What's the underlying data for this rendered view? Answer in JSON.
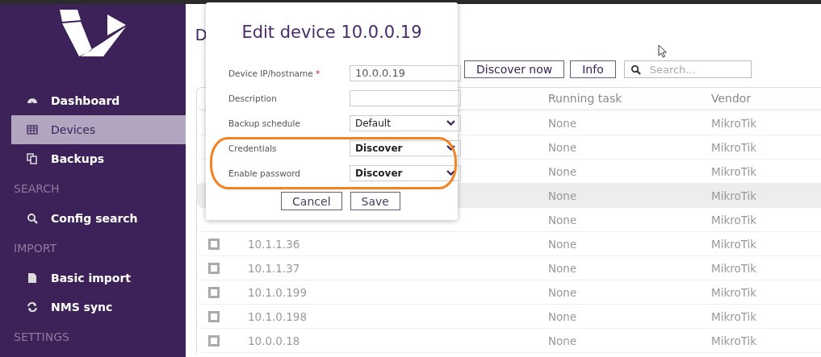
{
  "sidebar": {
    "items": [
      {
        "kind": "item",
        "label": "Dashboard",
        "selected": false
      },
      {
        "kind": "item",
        "label": "Devices",
        "selected": true
      },
      {
        "kind": "item",
        "label": "Backups",
        "selected": false
      },
      {
        "kind": "section",
        "label": "SEARCH"
      },
      {
        "kind": "item",
        "label": "Config search",
        "selected": false
      },
      {
        "kind": "section",
        "label": "IMPORT"
      },
      {
        "kind": "item",
        "label": "Basic import",
        "selected": false
      },
      {
        "kind": "item",
        "label": "NMS sync",
        "selected": false
      },
      {
        "kind": "section",
        "label": "SETTINGS"
      }
    ]
  },
  "page_title": "D",
  "toolbar": {
    "buttons": [
      "Discover now",
      "Info"
    ],
    "search": {
      "placeholder": "Search..."
    }
  },
  "table": {
    "columns": [
      "Running task",
      "Vendor"
    ],
    "rows": [
      {
        "running_task": "None",
        "vendor": "MikroTik",
        "selected": false
      },
      {
        "running_task": "None",
        "vendor": "MikroTik",
        "selected": false
      },
      {
        "running_task": "None",
        "vendor": "MikroTik",
        "selected": false
      },
      {
        "running_task": "None",
        "vendor": "MikroTik",
        "selected": true
      },
      {
        "running_task": "None",
        "vendor": "MikroTik",
        "selected": false
      },
      {
        "ip": "10.1.1.36",
        "running_task": "None",
        "vendor": "MikroTik",
        "selected": false,
        "checked": false
      },
      {
        "ip": "10.1.1.37",
        "running_task": "None",
        "vendor": "MikroTik",
        "selected": false,
        "checked": false
      },
      {
        "ip": "10.1.0.199",
        "running_task": "None",
        "vendor": "MikroTik",
        "selected": false,
        "checked": false
      },
      {
        "ip": "10.1.0.198",
        "running_task": "None",
        "vendor": "MikroTik",
        "selected": false,
        "checked": false
      },
      {
        "ip": "10.0.0.18",
        "running_task": "None",
        "vendor": "MikroTik",
        "selected": false,
        "checked": false
      }
    ]
  },
  "dialog": {
    "title": "Edit device 10.0.0.19",
    "fields": [
      {
        "kind": "text",
        "label": "Device IP/hostname",
        "required_mark": "*",
        "value": "10.0.0.19"
      },
      {
        "kind": "text",
        "label": "Description"
      },
      {
        "kind": "select",
        "label": "Backup schedule",
        "value": "Default",
        "highlighted": false
      },
      {
        "kind": "select",
        "label": "Credentials",
        "value": "Discover",
        "highlighted": true
      },
      {
        "kind": "select",
        "label": "Enable password",
        "value": "Discover",
        "highlighted": true
      }
    ],
    "buttons": [
      "Cancel",
      "Save"
    ]
  }
}
